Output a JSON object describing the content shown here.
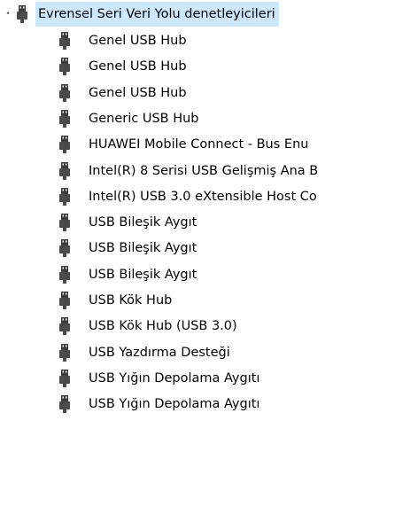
{
  "tree": {
    "parent": {
      "label": "Evrensel Seri Veri Yolu denetleyicileri",
      "icon": "usb-connector-icon",
      "expanded": true
    },
    "children": [
      {
        "label": "Genel USB Hub",
        "icon": "usb-connector-icon"
      },
      {
        "label": "Genel USB Hub",
        "icon": "usb-connector-icon"
      },
      {
        "label": "Genel USB Hub",
        "icon": "usb-connector-icon"
      },
      {
        "label": "Generic USB Hub",
        "icon": "usb-connector-icon"
      },
      {
        "label": "HUAWEI Mobile Connect - Bus Enu",
        "icon": "usb-connector-icon"
      },
      {
        "label": "Intel(R) 8 Serisi USB Gelişmiş Ana B",
        "icon": "usb-connector-icon"
      },
      {
        "label": "Intel(R) USB 3.0 eXtensible Host Co",
        "icon": "usb-connector-icon"
      },
      {
        "label": "USB Bileşik Aygıt",
        "icon": "usb-connector-icon"
      },
      {
        "label": "USB Bileşik Aygıt",
        "icon": "usb-connector-icon"
      },
      {
        "label": "USB Bileşik Aygıt",
        "icon": "usb-connector-icon"
      },
      {
        "label": "USB Kök Hub",
        "icon": "usb-connector-icon"
      },
      {
        "label": "USB Kök Hub (USB 3.0)",
        "icon": "usb-connector-icon"
      },
      {
        "label": "USB Yazdırma Desteği",
        "icon": "usb-connector-icon"
      },
      {
        "label": "USB Yığın Depolama Aygıtı",
        "icon": "usb-connector-icon"
      },
      {
        "label": "USB Yığın Depolama Aygıtı",
        "icon": "usb-connector-icon"
      }
    ]
  },
  "colors": {
    "selection": "#cce8ff",
    "icon": "#3c3c3c",
    "text": "#000000"
  }
}
